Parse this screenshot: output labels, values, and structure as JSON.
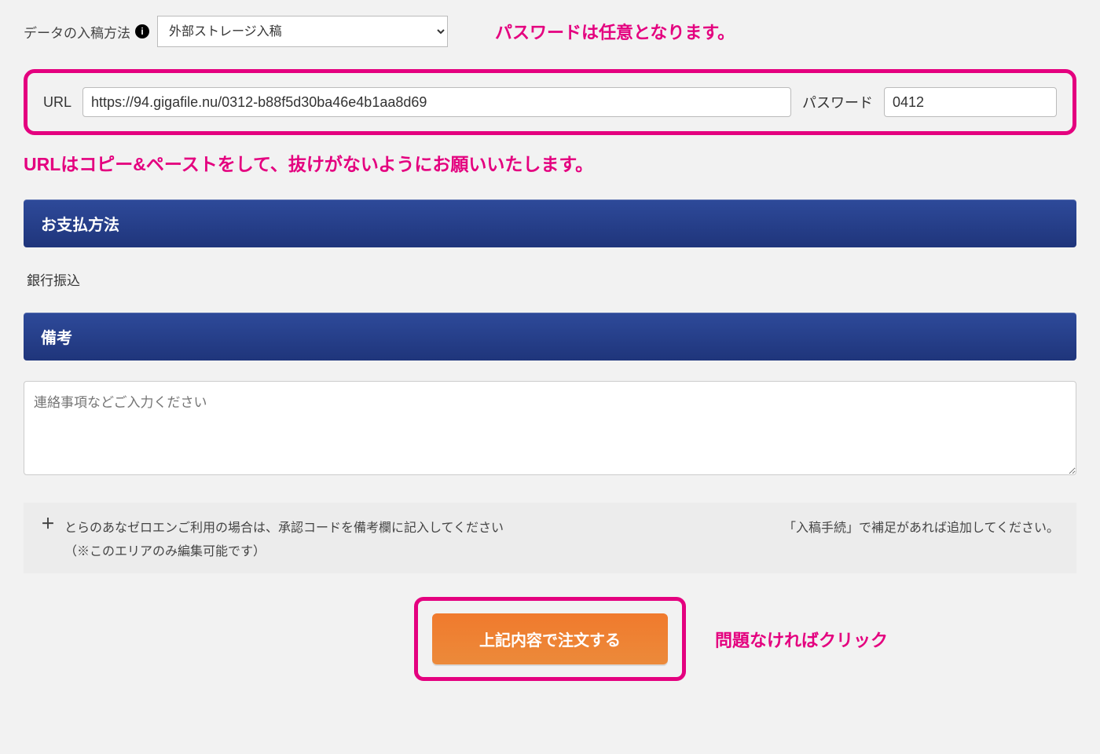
{
  "upload": {
    "label": "データの入稿方法",
    "info_icon": "i",
    "select_value": "外部ストレージ入稿"
  },
  "annotations": {
    "password_optional": "パスワードは任意となります。",
    "url_copy_paste": "URLはコピー&ペーストをして、抜けがないようにお願いいたします。",
    "submit_hint": "問題なければクリック"
  },
  "url_row": {
    "url_label": "URL",
    "url_value": "https://94.gigafile.nu/0312-b88f5d30ba46e4b1aa8d69",
    "password_label": "パスワード",
    "password_value": "0412"
  },
  "sections": {
    "payment_header": "お支払方法",
    "payment_value": "銀行振込",
    "notes_header": "備考",
    "notes_placeholder": "連絡事項などご入力ください"
  },
  "hint": {
    "plus": "＋",
    "left_line1": "とらのあなゼロエンご利用の場合は、承認コードを備考欄に記入してください",
    "left_line2": "（※このエリアのみ編集可能です）",
    "right": "「入稿手続」で補足があれば追加してください。"
  },
  "submit": {
    "label": "上記内容で注文する"
  }
}
